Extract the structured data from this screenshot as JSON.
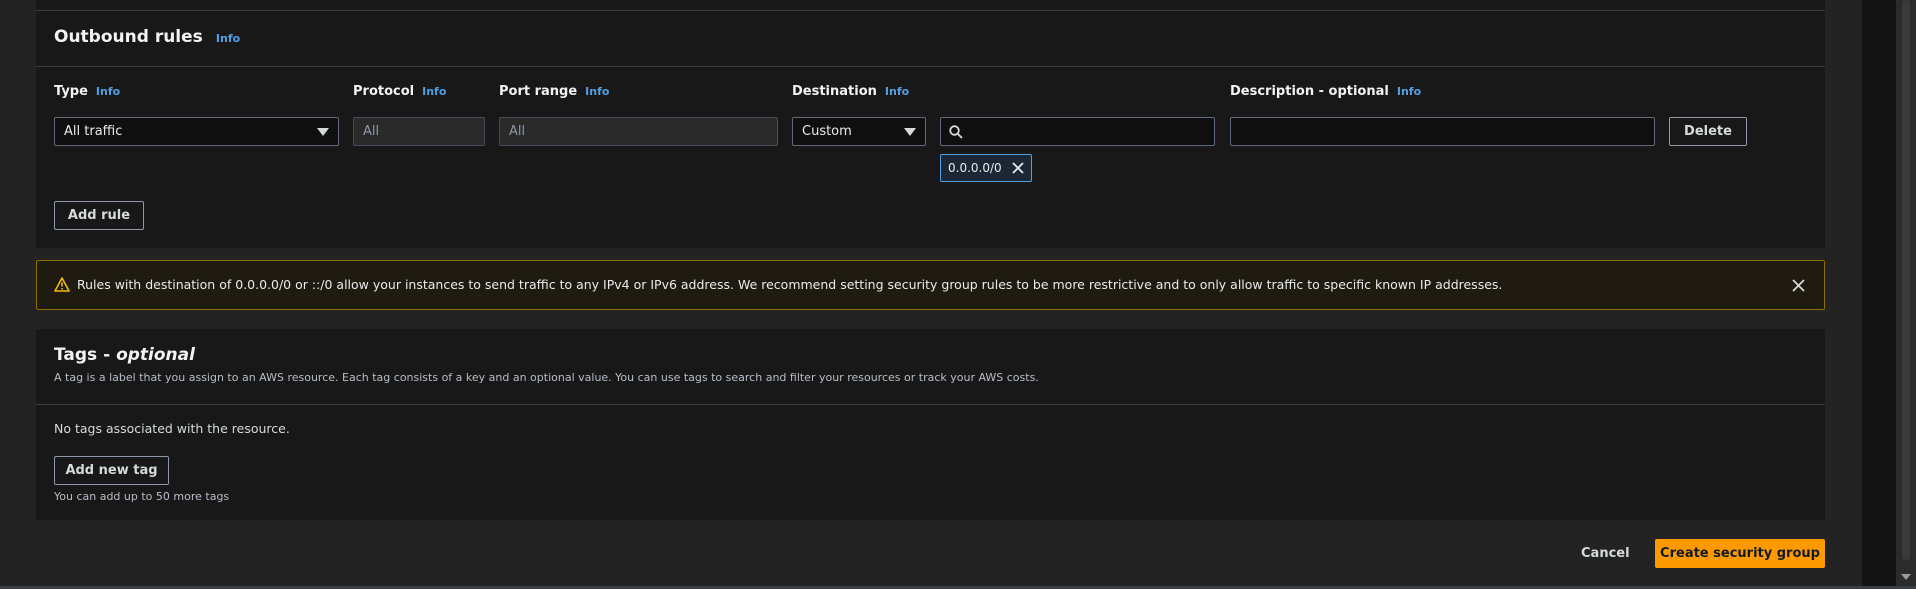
{
  "outbound": {
    "title": "Outbound rules",
    "info": "Info",
    "columns": {
      "type": "Type",
      "protocol": "Protocol",
      "port_range": "Port range",
      "destination": "Destination",
      "description": "Description - optional"
    },
    "rule": {
      "type_value": "All traffic",
      "protocol_value": "All",
      "port_value": "All",
      "destination_mode": "Custom",
      "destination_search": "",
      "description_value": "",
      "cidr_token": "0.0.0.0/0",
      "delete_label": "Delete"
    },
    "add_rule_label": "Add rule"
  },
  "warning": {
    "text": "Rules with destination of 0.0.0.0/0 or ::/0 allow your instances to send traffic to any IPv4 or IPv6 address. We recommend setting security group rules to be more restrictive and to only allow traffic to specific known IP addresses.",
    "accent_color": "#8c6e00"
  },
  "tags": {
    "title": "Tags - ",
    "title_italic": "optional",
    "description": "A tag is a label that you assign to an AWS resource. Each tag consists of a key and an optional value. You can use tags to search and filter your resources or track your AWS costs.",
    "empty_text": "No tags associated with the resource.",
    "add_label": "Add new tag",
    "limit_text": "You can add up to 50 more tags"
  },
  "footer": {
    "cancel_label": "Cancel",
    "create_label": "Create security group",
    "primary_color": "#ff9900"
  },
  "icons": [
    "search-icon",
    "close-icon",
    "warning-icon",
    "caret-down-icon"
  ]
}
